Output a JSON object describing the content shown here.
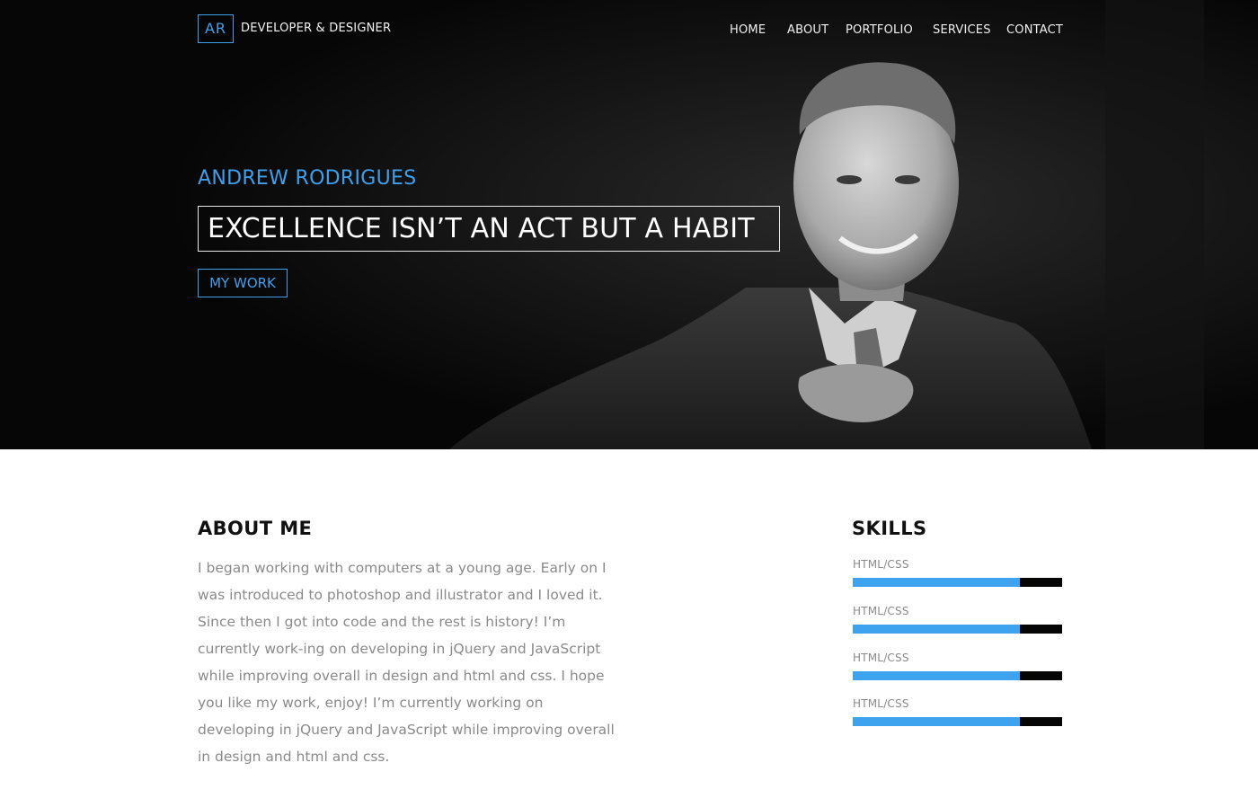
{
  "header": {
    "logo_initials": "AR",
    "logo_text": "DEVELOPER & DESIGNER",
    "nav": [
      "HOME",
      "ABOUT",
      "PORTFOLIO",
      "SERVICES",
      "CONTACT"
    ]
  },
  "hero": {
    "name": "ANDREW RODRIGUES",
    "quote": "EXCELLENCE ISN’T AN ACT BUT A HABIT",
    "button": "MY WORK"
  },
  "about": {
    "title": "ABOUT ME",
    "text": "I began working with computers at a young age. Early on I was introduced to photoshop and illustrator and I loved it. Since then I got into code and the rest is history! I’m currently work-ing on developing in jQuery and JavaScript while improving overall in design and html and css. I hope you like my work, enjoy! I’m currently working on developing in jQuery and JavaScript while improving overall in design and html and css."
  },
  "skills": {
    "title": "SKILLS",
    "items": [
      {
        "label": "HTML/CSS",
        "level": 0.8
      },
      {
        "label": "HTML/CSS",
        "level": 0.8
      },
      {
        "label": "HTML/CSS",
        "level": 0.8
      },
      {
        "label": "HTML/CSS",
        "level": 0.8
      }
    ]
  },
  "colors": {
    "accent": "#3ea0ec",
    "hero_bg": "#060606",
    "text_muted": "#8a8a8a"
  }
}
